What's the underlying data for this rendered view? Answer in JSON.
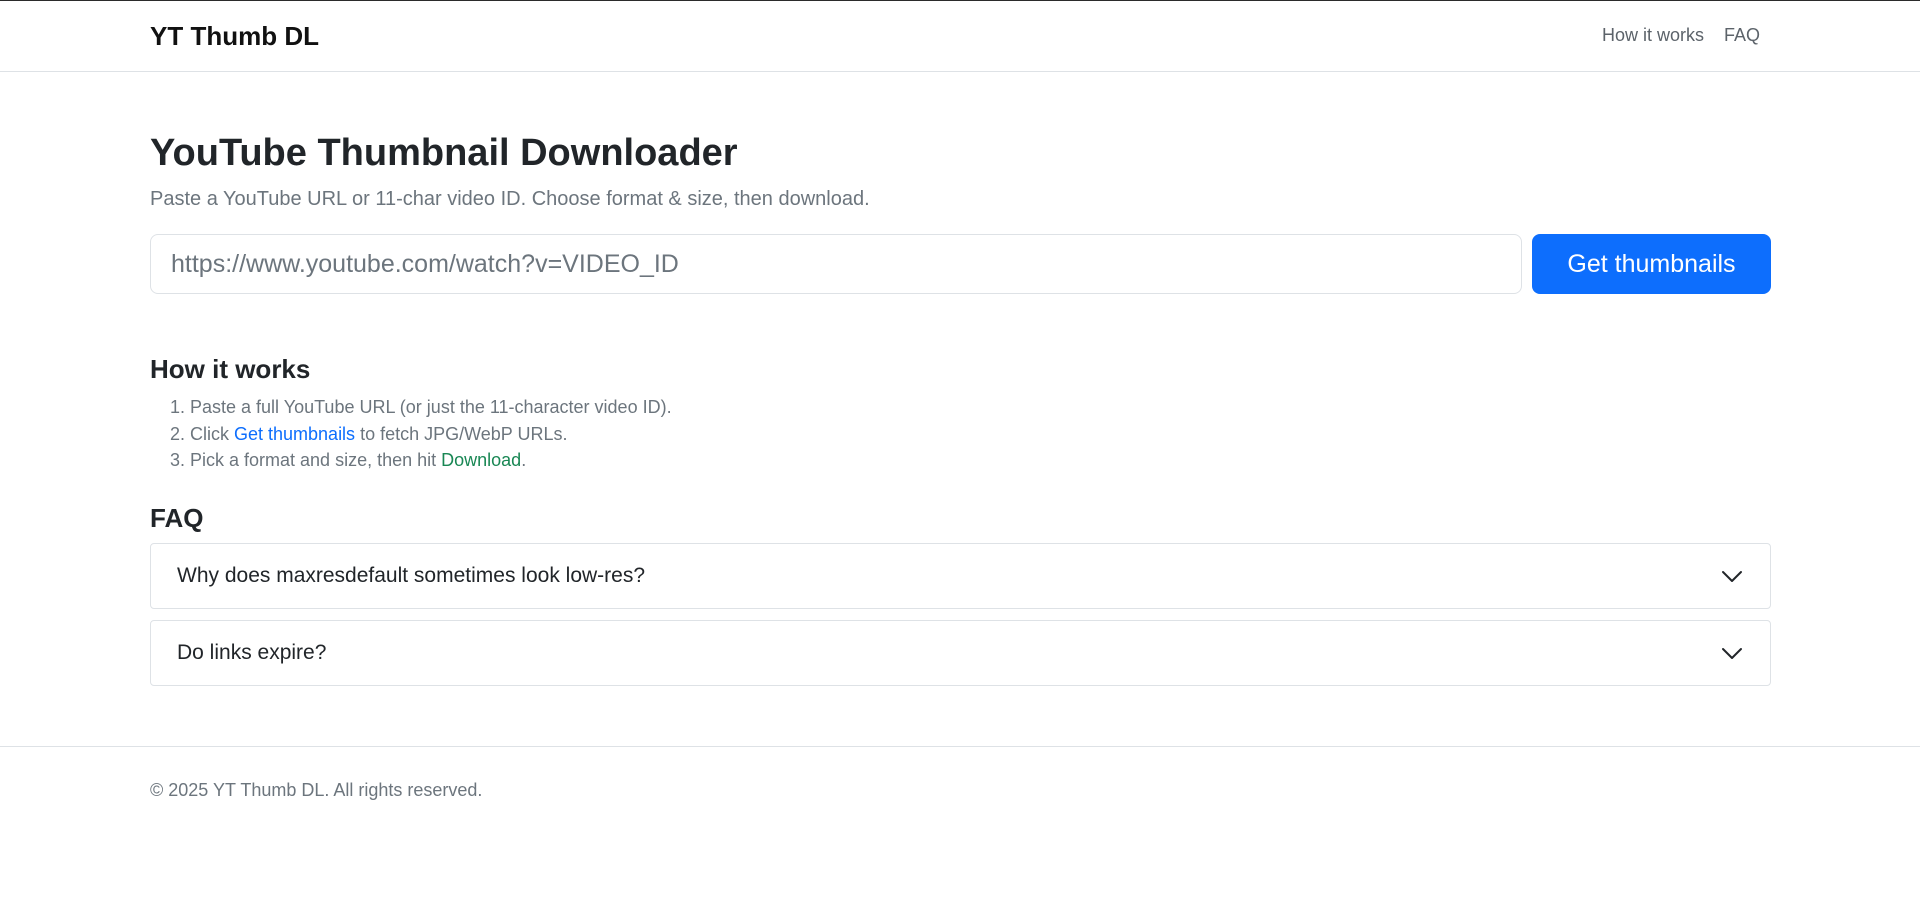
{
  "navbar": {
    "brand": "YT Thumb DL",
    "links": [
      {
        "label": "How it works"
      },
      {
        "label": "FAQ"
      }
    ]
  },
  "hero": {
    "title": "YouTube Thumbnail Downloader",
    "subtitle": "Paste a YouTube URL or 11-char video ID. Choose format & size, then download."
  },
  "search": {
    "placeholder": "https://www.youtube.com/watch?v=VIDEO_ID",
    "value": "",
    "button_label": "Get thumbnails"
  },
  "how_it_works": {
    "title": "How it works",
    "steps": [
      {
        "num": "1.",
        "pre": "Paste a full YouTube URL (or just the 11-character video ID).",
        "link": "",
        "post": ""
      },
      {
        "num": "2.",
        "pre": "Click ",
        "link": "Get thumbnails",
        "post": " to fetch JPG/WebP URLs."
      },
      {
        "num": "3.",
        "pre": "Pick a format and size, then hit ",
        "link": "Download",
        "post": "."
      }
    ]
  },
  "faq": {
    "title": "FAQ",
    "items": [
      {
        "question": "Why does maxresdefault sometimes look low-res?",
        "icon": "chevron-down-icon"
      },
      {
        "question": "Do links expire?",
        "icon": "chevron-down-icon"
      }
    ]
  },
  "footer": {
    "copyright": "© 2025 YT Thumb DL. All rights reserved."
  },
  "colors": {
    "primary": "#0d6efd",
    "success": "#198754",
    "muted": "#6c757d",
    "border": "#dee2e6"
  }
}
